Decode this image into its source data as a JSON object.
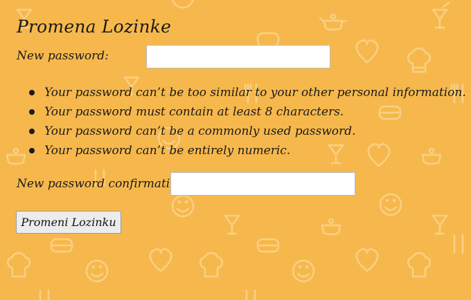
{
  "page": {
    "title": "Promena Lozinke",
    "background_color": "#f6b84c"
  },
  "form": {
    "new_password_label": "New password:",
    "new_password_value": "",
    "password_rules": [
      "Your password can’t be too similar to your other personal information.",
      "Your password must contain at least 8 characters.",
      "Your password can’t be a commonly used password.",
      "Your password can’t be entirely numeric."
    ],
    "confirm_label": "New password confirmation:",
    "confirm_value": "",
    "submit_label": "Promeni Lozinku"
  },
  "background_icons": [
    "cocktail-icon",
    "heart-icon",
    "chef-hat-icon",
    "smiley-icon",
    "sandwich-icon",
    "teapot-icon",
    "cutlery-icon"
  ]
}
